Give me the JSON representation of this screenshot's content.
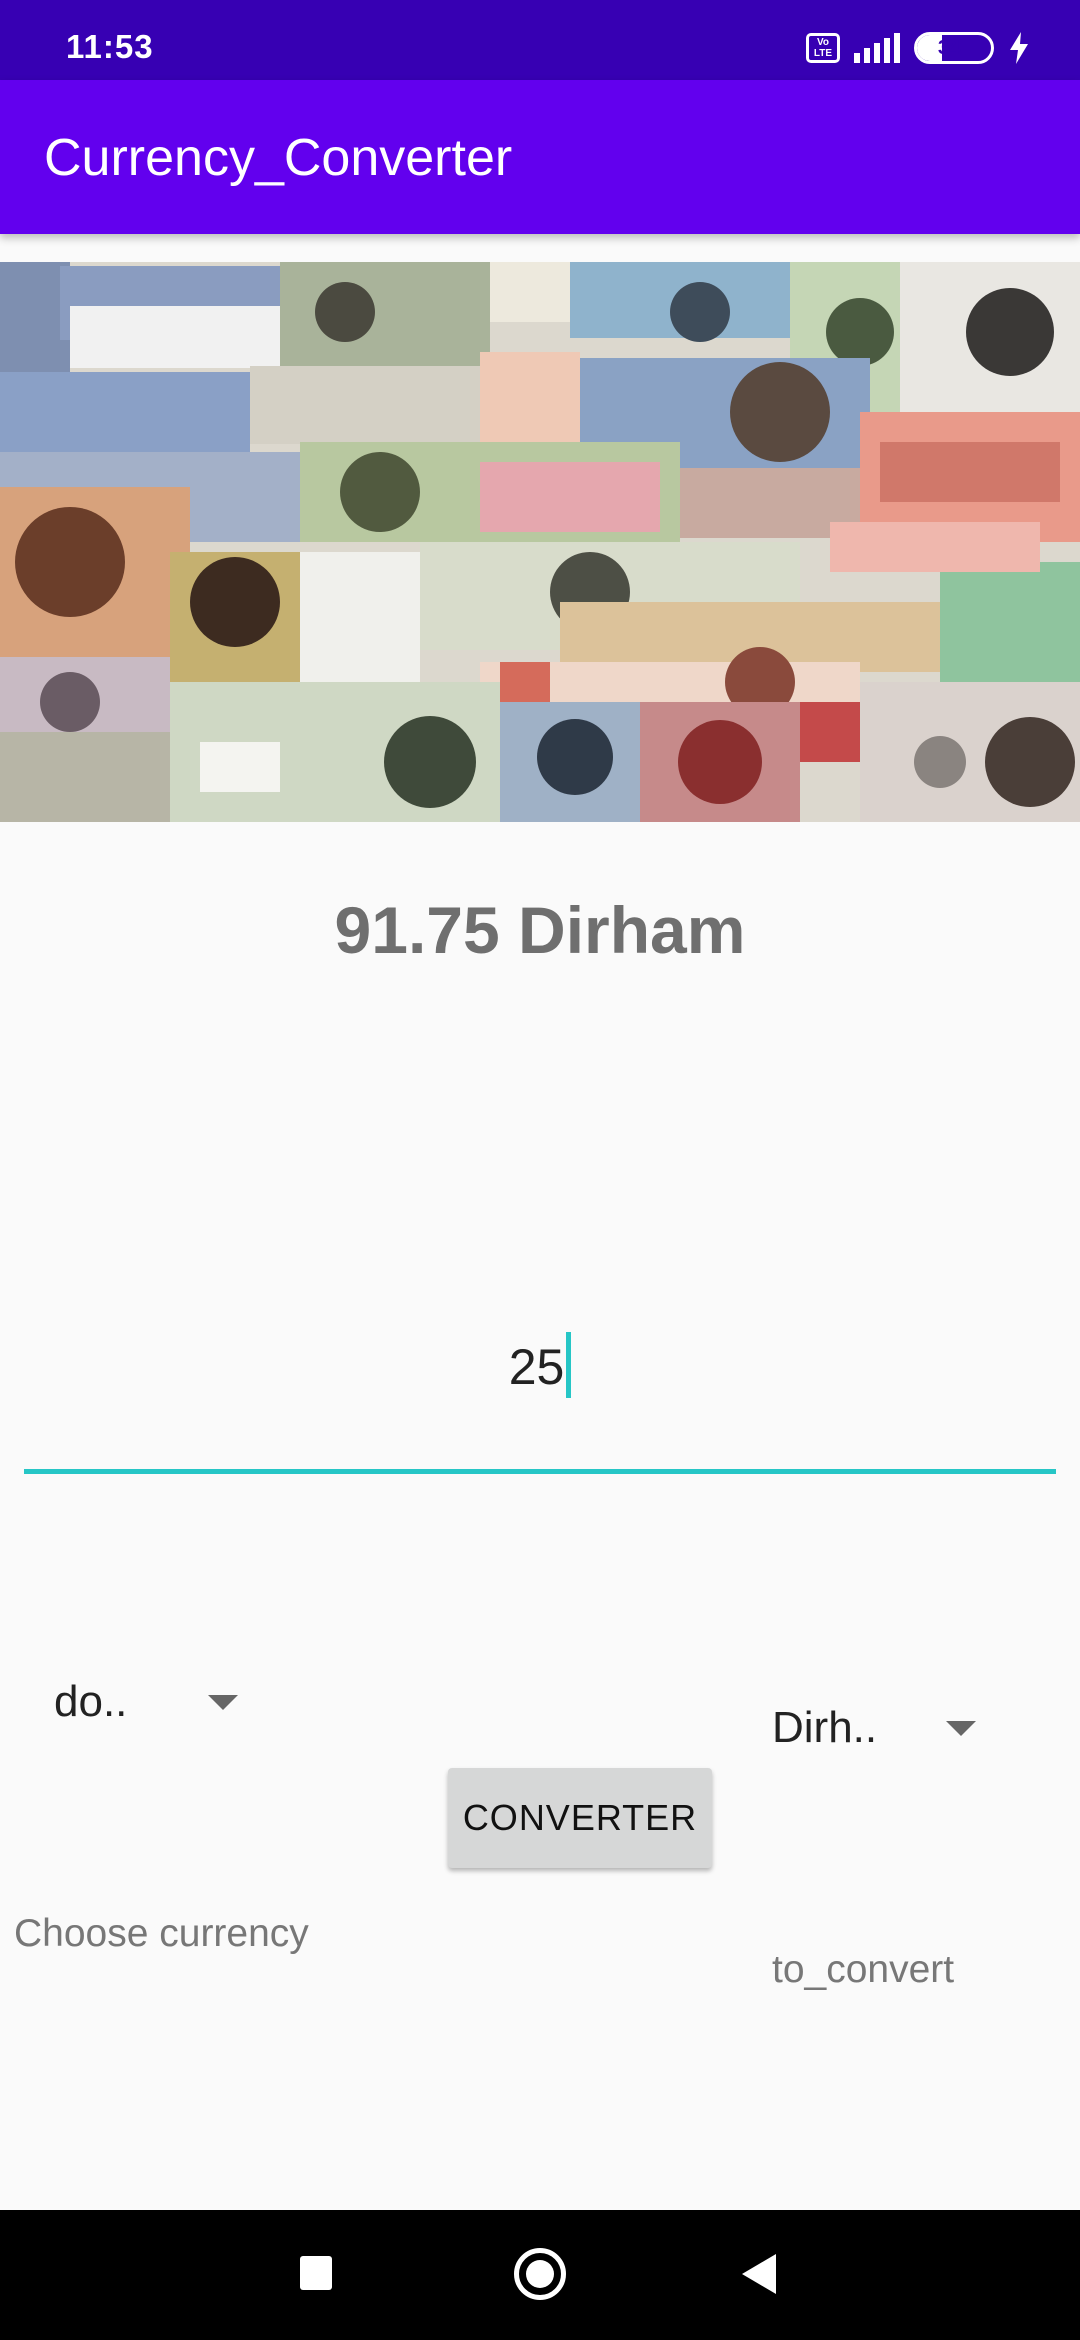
{
  "status_bar": {
    "time": "11:53",
    "network_badge": "Vo LTE",
    "battery_level": "34",
    "battery_fraction": 0.34
  },
  "app_bar": {
    "title": "Currency_Converter"
  },
  "banner": {
    "icon": "banknotes-collage-image"
  },
  "main": {
    "result_text": "91.75 Dirham",
    "amount_value": "25",
    "from_currency": "do..",
    "to_currency": "Dirh..",
    "convert_button": "CONVERTER",
    "from_label": "Choose currency",
    "to_label": "to_convert"
  },
  "colors": {
    "status_bar": "#3700b3",
    "app_bar": "#6200ee",
    "accent": "#26c6c6",
    "result_text": "#6f6f6f"
  },
  "nav_bar": {
    "icons": [
      "recent-apps-icon",
      "home-icon",
      "back-icon"
    ]
  }
}
